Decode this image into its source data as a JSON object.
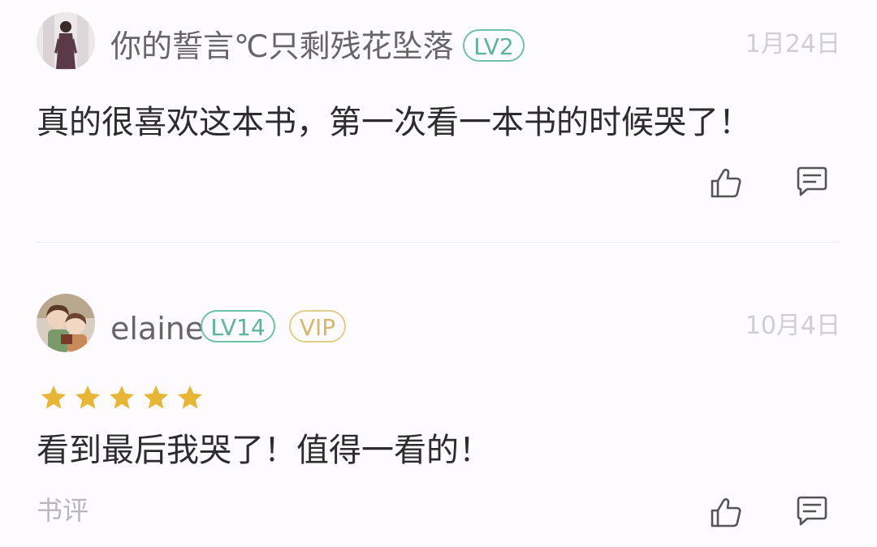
{
  "comments": [
    {
      "username": "你的誓言℃只剩残花坠落",
      "level_badge": "LV2",
      "date": "1月24日",
      "text": "真的很喜欢这本书，第一次看一本书的时候哭了！"
    },
    {
      "username": "elaine",
      "level_badge": "LV14",
      "vip_badge": "VIP",
      "date": "10月4日",
      "rating": 5,
      "text": "看到最后我哭了！值得一看的！",
      "tag": "书评"
    }
  ],
  "colors": {
    "level_badge": "#5ab59a",
    "vip_badge": "#d6b86a",
    "star": "#e8b637",
    "icon": "#555555"
  },
  "icons": {
    "like": "thumbs-up-icon",
    "reply": "comment-icon"
  }
}
